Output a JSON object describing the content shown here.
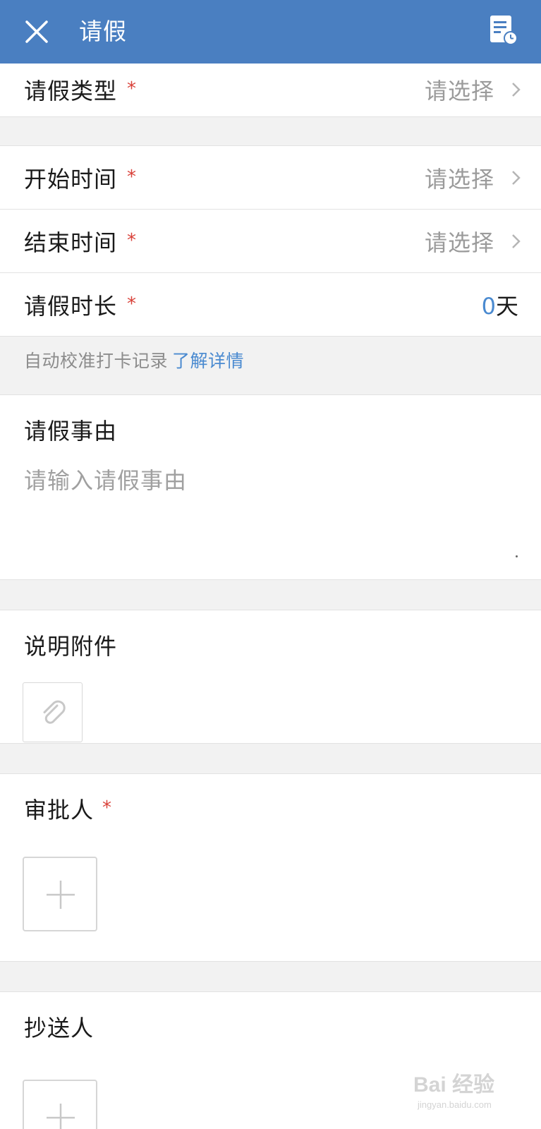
{
  "header": {
    "title": "请假",
    "close_icon": "close-icon",
    "history_icon": "history-icon",
    "bg_color": "#4a7fc1"
  },
  "form": {
    "leave_type": {
      "label": "请假类型",
      "required_mark": "*",
      "value": "请选择"
    },
    "start_time": {
      "label": "开始时间",
      "required_mark": "*",
      "value": "请选择"
    },
    "end_time": {
      "label": "结束时间",
      "required_mark": "*",
      "value": "请选择"
    },
    "duration": {
      "label": "请假时长",
      "required_mark": "*",
      "number": "0",
      "unit": "天"
    },
    "hint": {
      "text": "自动校准打卡记录",
      "link": "了解详情"
    },
    "reason": {
      "label": "请假事由",
      "placeholder": "请输入请假事由"
    },
    "attachment": {
      "label": "说明附件",
      "icon": "paperclip-icon"
    },
    "approver": {
      "label": "审批人",
      "required_mark": "*",
      "icon": "plus-icon"
    },
    "cc": {
      "label": "抄送人",
      "icon": "plus-icon"
    }
  },
  "colors": {
    "required": "#d9423a",
    "link": "#4a8ad0",
    "placeholder": "#9b9b9b"
  },
  "watermark": {
    "text": "Bai 经验",
    "sub": "jingyan.baidu.com"
  }
}
